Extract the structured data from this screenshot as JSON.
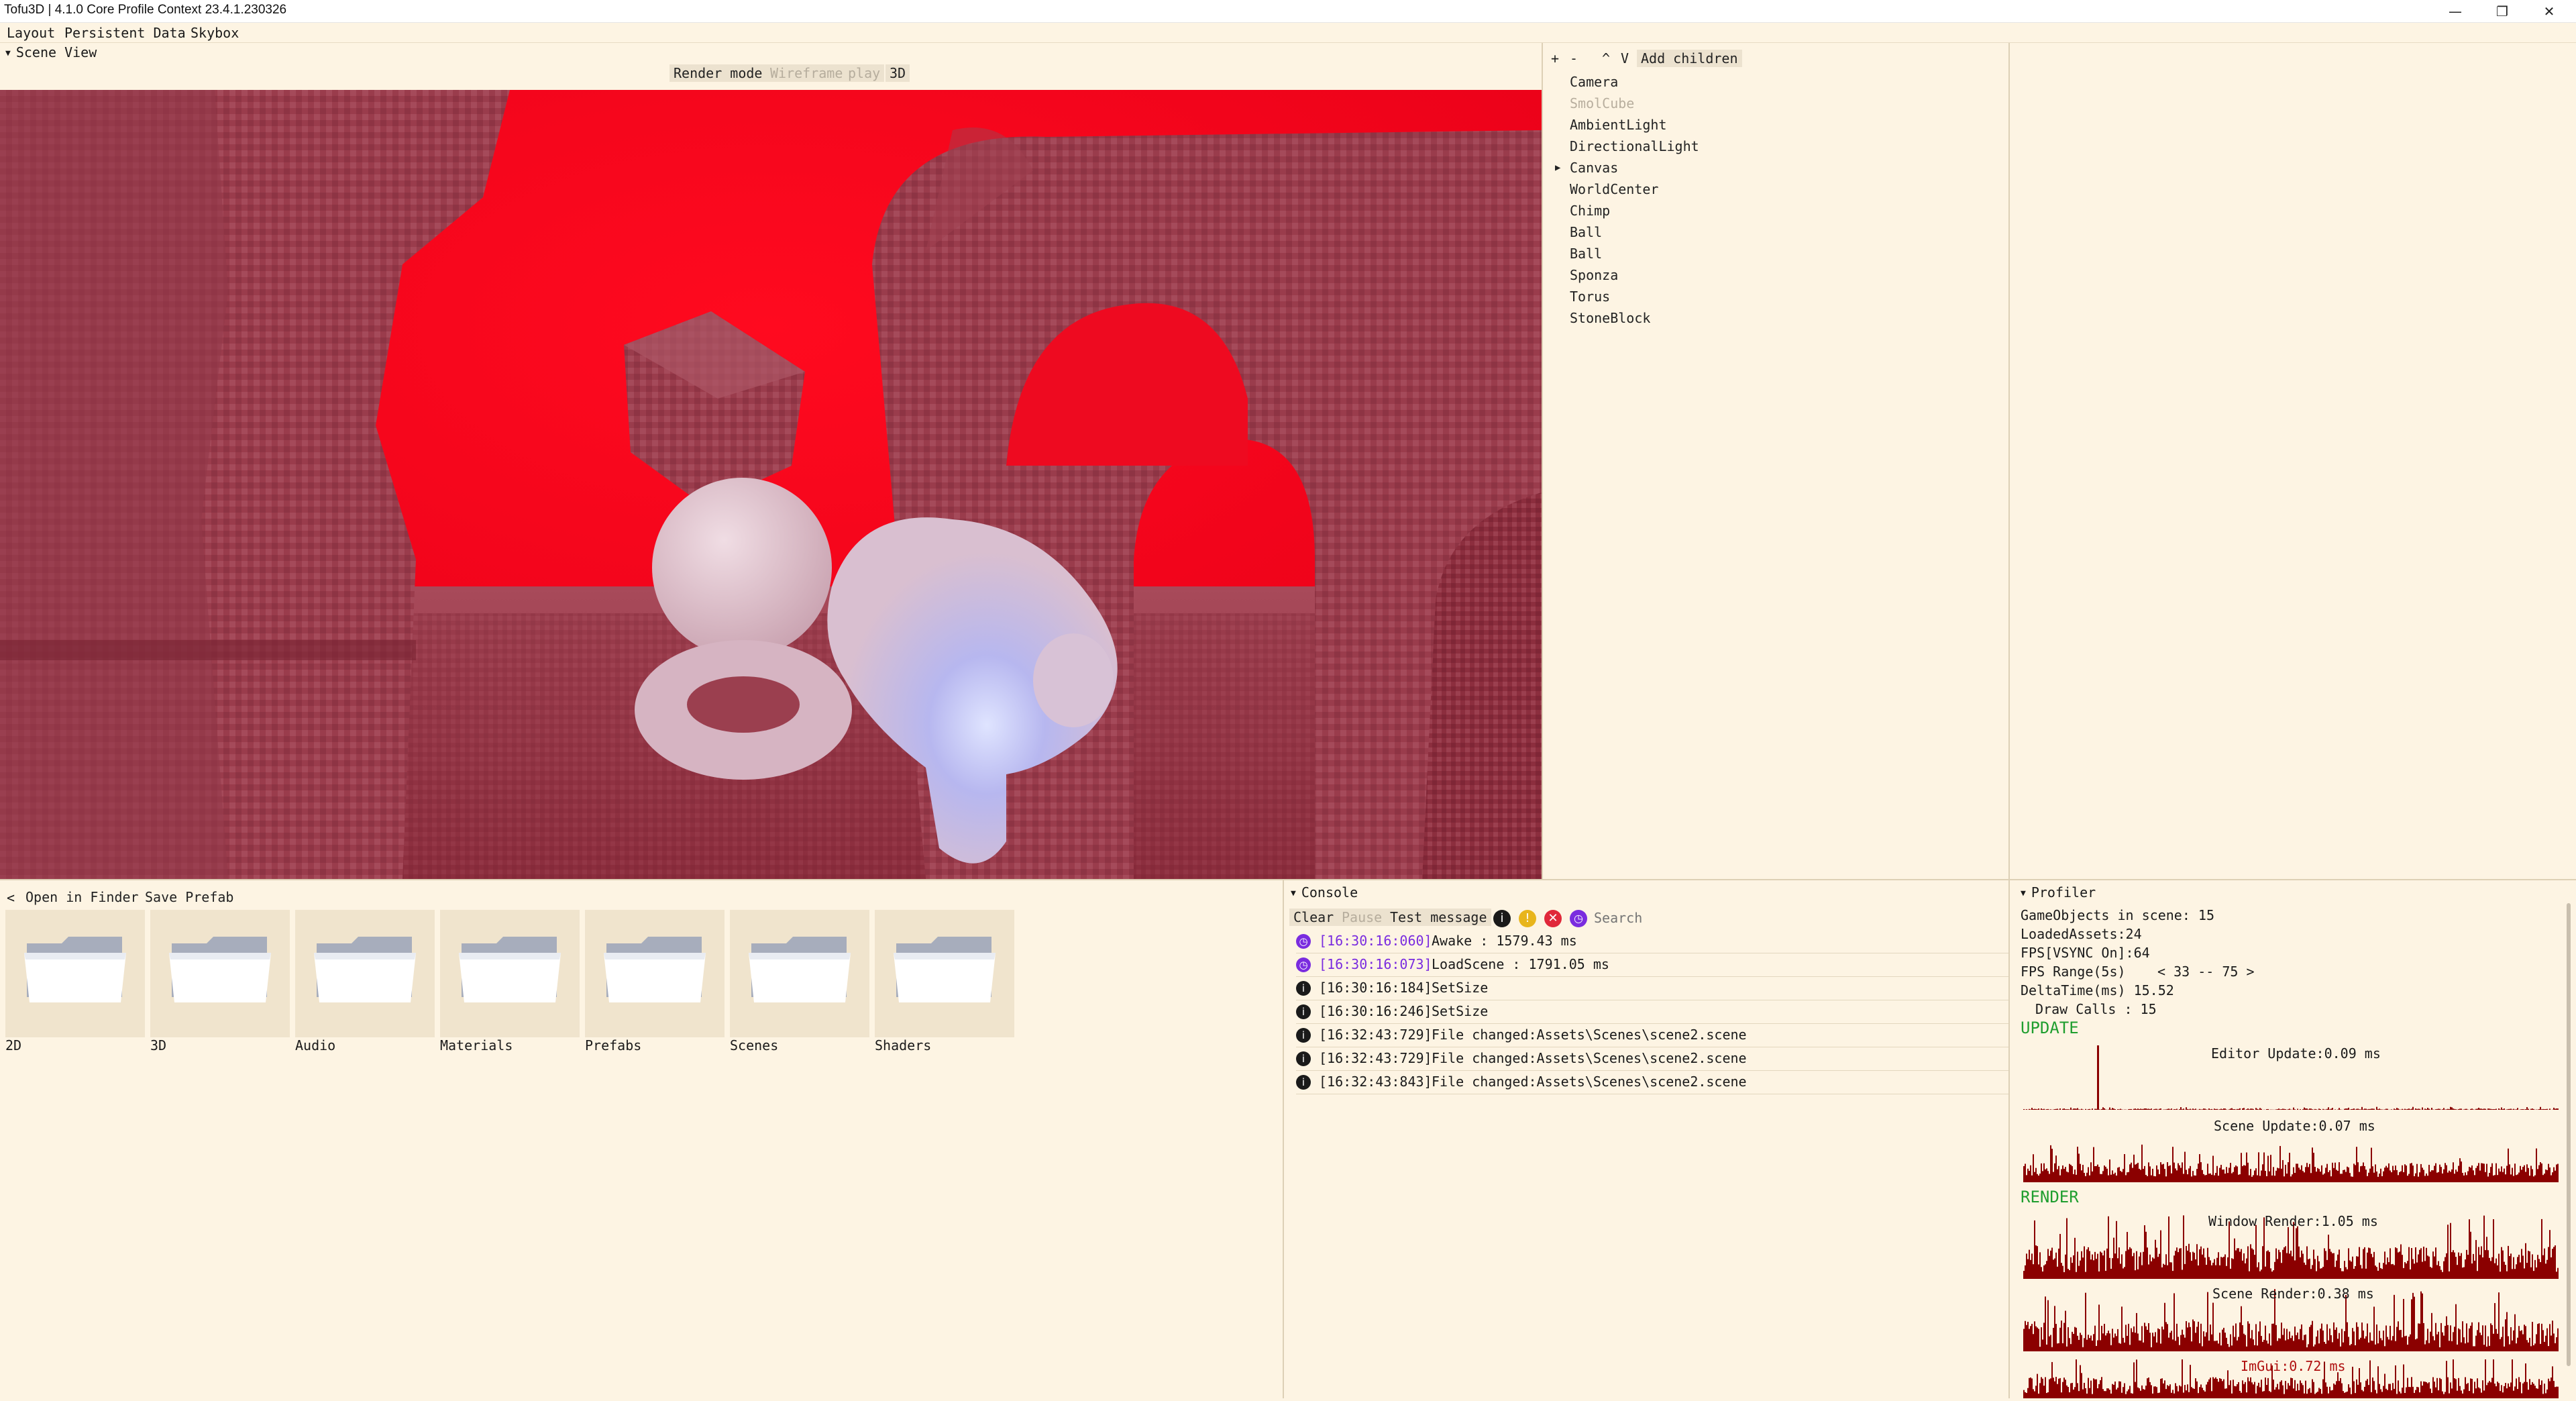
{
  "window": {
    "title": "Tofu3D | 4.1.0 Core Profile Context 23.4.1.230326",
    "minimize": "—",
    "restore": "❐",
    "close": "✕"
  },
  "menu": [
    "Layout",
    "Persistent Data",
    "Skybox"
  ],
  "scene_view": {
    "header": "Scene View",
    "render_mode": "Render mode",
    "wireframe": "Wireframe",
    "play": "play",
    "mode_3d": "3D"
  },
  "hierarchy": {
    "toolbar": {
      "plus": "+",
      "minus": "-",
      "up": "^",
      "down": "V",
      "add_children": "Add children"
    },
    "items": [
      {
        "label": "Camera",
        "dim": false,
        "expandable": false
      },
      {
        "label": "SmolCube",
        "dim": true,
        "expandable": false
      },
      {
        "label": "AmbientLight",
        "dim": false,
        "expandable": false
      },
      {
        "label": "DirectionalLight",
        "dim": false,
        "expandable": false
      },
      {
        "label": "Canvas",
        "dim": false,
        "expandable": true
      },
      {
        "label": "WorldCenter",
        "dim": false,
        "expandable": false
      },
      {
        "label": "Chimp",
        "dim": false,
        "expandable": false
      },
      {
        "label": "Ball",
        "dim": false,
        "expandable": false
      },
      {
        "label": "Ball",
        "dim": false,
        "expandable": false
      },
      {
        "label": "Sponza",
        "dim": false,
        "expandable": false
      },
      {
        "label": "Torus",
        "dim": false,
        "expandable": false
      },
      {
        "label": "StoneBlock",
        "dim": false,
        "expandable": false
      }
    ]
  },
  "assets": {
    "back": "<",
    "open_in_finder": "Open in Finder",
    "save_prefab": "Save Prefab",
    "folders": [
      "2D",
      "3D",
      "Audio",
      "Materials",
      "Prefabs",
      "Scenes",
      "Shaders"
    ]
  },
  "console": {
    "header": "Console",
    "clear": "Clear",
    "pause": "Pause",
    "test_message": "Test message",
    "search_placeholder": "Search",
    "logs": [
      {
        "type": "timer",
        "ts": "[16:30:16:060]",
        "msg": "Awake : 1579.43 ms"
      },
      {
        "type": "timer",
        "ts": "[16:30:16:073]",
        "msg": "LoadScene : 1791.05 ms"
      },
      {
        "type": "info",
        "ts": "[16:30:16:184]",
        "msg": "SetSize"
      },
      {
        "type": "info",
        "ts": "[16:30:16:246]",
        "msg": "SetSize"
      },
      {
        "type": "info",
        "ts": "[16:32:43:729]",
        "msg": "File changed:Assets\\Scenes\\scene2.scene"
      },
      {
        "type": "info",
        "ts": "[16:32:43:729]",
        "msg": "File changed:Assets\\Scenes\\scene2.scene"
      },
      {
        "type": "info",
        "ts": "[16:32:43:843]",
        "msg": "File changed:Assets\\Scenes\\scene2.scene"
      }
    ]
  },
  "profiler": {
    "header": "Profiler",
    "gameobjects": "GameObjects in scene: 15",
    "loaded_assets": "LoadedAssets:24",
    "fps": "FPS[VSYNC On]:64",
    "fps_range_label": "FPS Range(5s)",
    "fps_range_value": "< 33 -- 75 >",
    "delta_time": "DeltaTime(ms) 15.52",
    "draw_calls": "Draw Calls : 15",
    "update_section": "UPDATE",
    "render_section": "RENDER",
    "editor_update": "Editor Update:0.09 ms",
    "scene_update": "Scene Update:0.07 ms",
    "window_render": "Window Render:1.05 ms",
    "scene_render": "Scene Render:0.38 ms",
    "imgui": "ImGui:0.72 ms"
  },
  "colors": {
    "background": "#fdf4e3",
    "graph": "#8b0000",
    "section_green": "#1f9e2f",
    "timer_icon": "#7a2cdf",
    "warning_icon": "#e8b51c",
    "error_icon": "#e0283a"
  }
}
